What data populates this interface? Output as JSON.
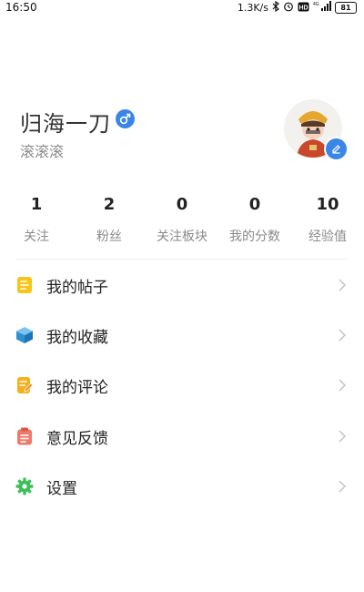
{
  "status_bar": {
    "time": "16:50",
    "network_speed": "1.3K/s",
    "battery": "81",
    "hd_label": "HD",
    "network_type": "4G"
  },
  "profile": {
    "username": "归海一刀",
    "gender_symbol": "♂",
    "subtitle": "滚滚滚",
    "accent_color": "#3a86e8"
  },
  "stats": [
    {
      "value": "1",
      "label": "关注"
    },
    {
      "value": "2",
      "label": "粉丝"
    },
    {
      "value": "0",
      "label": "关注板块"
    },
    {
      "value": "0",
      "label": "我的分数"
    },
    {
      "value": "10",
      "label": "经验值"
    }
  ],
  "menu": [
    {
      "label": "我的帖子",
      "icon": "document-icon",
      "color": "#f5c518"
    },
    {
      "label": "我的收藏",
      "icon": "cube-icon",
      "color": "#3ba3e0"
    },
    {
      "label": "我的评论",
      "icon": "edit-note-icon",
      "color": "#f5b01a"
    },
    {
      "label": "意见反馈",
      "icon": "clipboard-icon",
      "color": "#f07a6a"
    },
    {
      "label": "设置",
      "icon": "gear-icon",
      "color": "#3cbf5a"
    }
  ]
}
